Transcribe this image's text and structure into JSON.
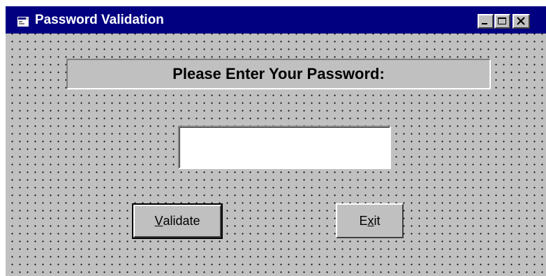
{
  "window": {
    "title": "Password Validation",
    "controls": {
      "minimize": "_",
      "maximize": "□",
      "close": "×"
    }
  },
  "form": {
    "prompt": "Please Enter Your Password:",
    "password_value": "",
    "validate_button": {
      "mnemonic": "V",
      "rest": "alidate"
    },
    "exit_button": {
      "before": "E",
      "mnemonic": "x",
      "after": "it"
    }
  },
  "colors": {
    "titlebar": "#000080",
    "face": "#c0c0c0",
    "title_text": "#ffffff"
  },
  "icons": {
    "app": "form-icon",
    "minimize": "minimize-icon",
    "maximize": "maximize-icon",
    "close": "close-icon"
  }
}
